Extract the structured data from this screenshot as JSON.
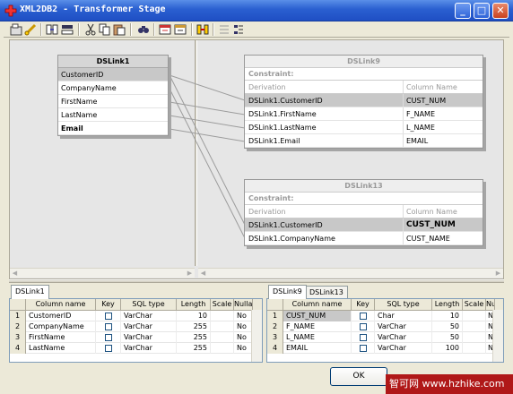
{
  "window": {
    "title": "XML2DB2 - Transformer Stage",
    "minimize_label": "_",
    "maximize_label": "□",
    "close_label": "✕"
  },
  "toolbar": {
    "icons": [
      "stage-properties-icon",
      "constraints-icon",
      "column-auto-match-icon",
      "input-link-order-icon",
      "cut-icon",
      "copy-icon",
      "paste-icon",
      "find-replace-icon",
      "load-column-definition-icon",
      "save-table-definition-icon",
      "column-auto-match-2-icon",
      "show-all-relations-icon",
      "show-links-icon"
    ]
  },
  "input_link": {
    "name": "DSLink1",
    "columns": [
      "CustomerID",
      "CompanyName",
      "FirstName",
      "LastName",
      "Email"
    ]
  },
  "output_links": [
    {
      "name": "DSLink9",
      "constraint_label": "Constraint:",
      "derivation_header": "Derivation",
      "column_name_header": "Column Name",
      "rows": [
        {
          "derivation": "DSLink1.CustomerID",
          "column": "CUST_NUM"
        },
        {
          "derivation": "DSLink1.FirstName",
          "column": "F_NAME"
        },
        {
          "derivation": "DSLink1.LastName",
          "column": "L_NAME"
        },
        {
          "derivation": "DSLink1.Email",
          "column": "EMAIL"
        }
      ]
    },
    {
      "name": "DSLink13",
      "constraint_label": "Constraint:",
      "derivation_header": "Derivation",
      "column_name_header": "Column Name",
      "rows": [
        {
          "derivation": "DSLink1.CustomerID",
          "column": "CUST_NUM"
        },
        {
          "derivation": "DSLink1.CompanyName",
          "column": "CUST_NAME"
        }
      ]
    }
  ],
  "left_grid": {
    "tabs": [
      "DSLink1"
    ],
    "headers": [
      "Column name",
      "Key",
      "SQL type",
      "Length",
      "Scale",
      "Nullable"
    ],
    "rows": [
      {
        "num": "1",
        "name": "CustomerID",
        "sql": "VarChar",
        "length": "10",
        "scale": "",
        "nullable": "No"
      },
      {
        "num": "2",
        "name": "CompanyName",
        "sql": "VarChar",
        "length": "255",
        "scale": "",
        "nullable": "No"
      },
      {
        "num": "3",
        "name": "FirstName",
        "sql": "VarChar",
        "length": "255",
        "scale": "",
        "nullable": "No"
      },
      {
        "num": "4",
        "name": "LastName",
        "sql": "VarChar",
        "length": "255",
        "scale": "",
        "nullable": "No"
      }
    ]
  },
  "right_grid": {
    "tabs": [
      "DSLink9",
      "DSLink13"
    ],
    "headers": [
      "Column name",
      "Key",
      "SQL type",
      "Length",
      "Scale",
      "Nu"
    ],
    "rows": [
      {
        "num": "1",
        "name": "CUST_NUM",
        "sql": "Char",
        "length": "10",
        "scale": "",
        "nullable": "N"
      },
      {
        "num": "2",
        "name": "F_NAME",
        "sql": "VarChar",
        "length": "50",
        "scale": "",
        "nullable": "N"
      },
      {
        "num": "3",
        "name": "L_NAME",
        "sql": "VarChar",
        "length": "50",
        "scale": "",
        "nullable": "N"
      },
      {
        "num": "4",
        "name": "EMAIL",
        "sql": "VarChar",
        "length": "100",
        "scale": "",
        "nullable": "N"
      }
    ]
  },
  "buttons": {
    "ok": "OK"
  },
  "watermark": "智可网 www.hzhike.com"
}
